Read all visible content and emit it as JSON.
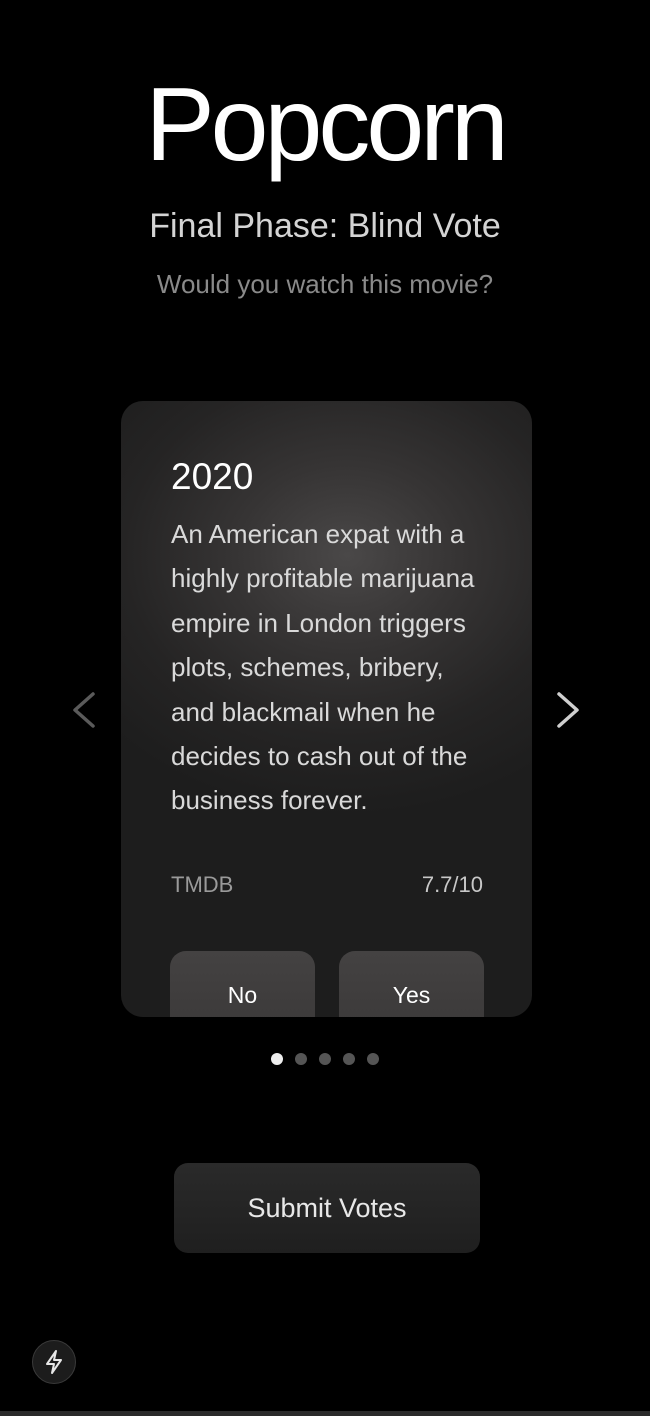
{
  "header": {
    "app_title": "Popcorn",
    "phase_title": "Final Phase: Blind Vote",
    "prompt": "Would you watch this movie?"
  },
  "card": {
    "year": "2020",
    "description": "An American expat with a highly profitable marijuana empire in London triggers plots, schemes, bribery, and blackmail when he decides to cash out of the business forever.",
    "source": "TMDB",
    "rating": "7.7/10",
    "no_label": "No",
    "yes_label": "Yes"
  },
  "carousel": {
    "total_slides": 5,
    "active_index": 0
  },
  "footer": {
    "submit_label": "Submit Votes"
  },
  "icons": {
    "prev": "chevron-left-icon",
    "next": "chevron-right-icon",
    "dev_tools": "lightning-bolt-icon"
  }
}
